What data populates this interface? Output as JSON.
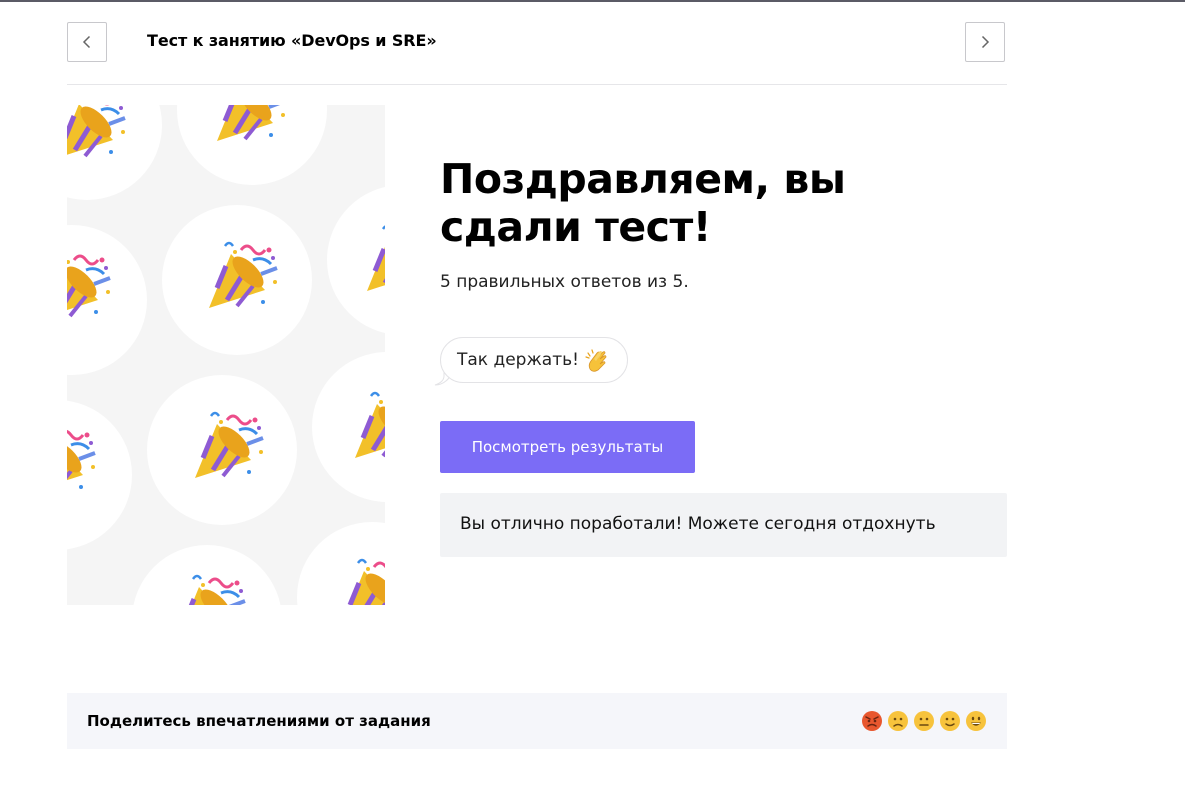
{
  "header": {
    "quiz_title": "Тест к занятию «DevOps и SRE»",
    "prev_icon": "chevron-left-icon",
    "next_icon": "chevron-right-icon"
  },
  "result": {
    "heading": "Поздравляем, вы сдали тест!",
    "score_text": "5 правильных ответов из 5.",
    "praise": "Так держать!",
    "praise_icon": "clapping-hands-icon",
    "results_button": "Посмотреть результаты",
    "note": "Вы отлично поработали! Можете сегодня отдохнуть"
  },
  "illustration": {
    "icon": "party-popper-icon"
  },
  "feedback": {
    "label": "Поделитесь впечатлениями от задания",
    "options": [
      "angry-face-icon",
      "frowning-face-icon",
      "neutral-face-icon",
      "slightly-smiling-face-icon",
      "grinning-face-icon"
    ]
  },
  "colors": {
    "accent": "#7b6cf6",
    "note_bg": "#f2f3f5",
    "feedback_bg": "#f5f6fa"
  }
}
